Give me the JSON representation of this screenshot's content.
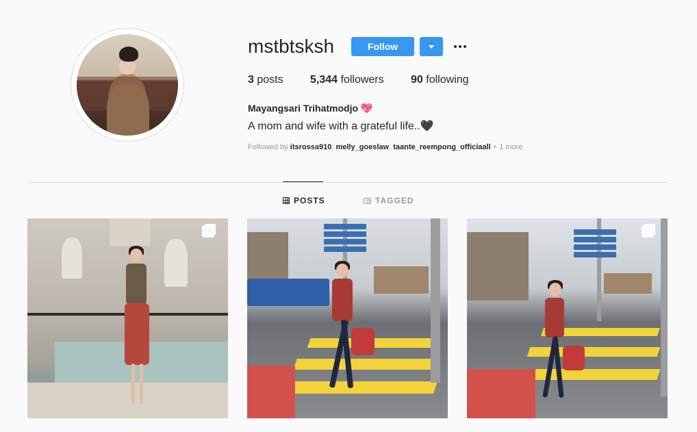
{
  "profile": {
    "username": "mstbtsksh",
    "follow_label": "Follow",
    "stats": {
      "posts_count": "3",
      "posts_label": "posts",
      "followers_count": "5,344",
      "followers_label": "followers",
      "following_count": "90",
      "following_label": "following"
    },
    "full_name": "Mayangsari Trihatmodjo 💖",
    "bio": "A mom and wife with a grateful life..🖤",
    "followed_by": {
      "prefix": "Followed by",
      "accounts": [
        "itsrossa910",
        "melly_goeslaw",
        "taante_reempong_officiaall"
      ],
      "more": "+ 1 more"
    }
  },
  "tabs": [
    {
      "label": "POSTS",
      "icon": "grid-icon",
      "active": true
    },
    {
      "label": "TAGGED",
      "icon": "tag-icon",
      "active": false
    }
  ],
  "posts": [
    {
      "scene": "woman posing at fountain",
      "multi": true
    },
    {
      "scene": "woman crossing street with red bag",
      "multi": false
    },
    {
      "scene": "woman crossing street with red bag",
      "multi": true
    }
  ],
  "colors": {
    "accent": "#3897f0",
    "background": "#fafafa",
    "text": "#262626",
    "muted": "#999999",
    "divider": "#dbdbdb"
  }
}
